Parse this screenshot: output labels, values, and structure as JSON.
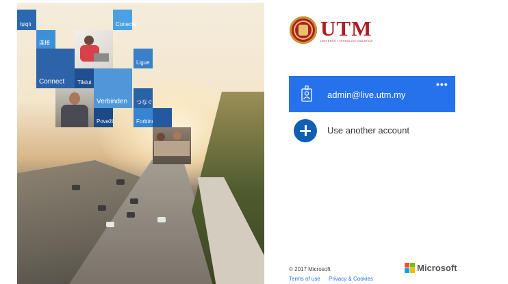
{
  "hero": {
    "tiles": [
      "Işiqlı",
      "连接",
      "Conecte",
      "Connect",
      "Ligue",
      "Verbinden",
      "つなぐ",
      "Forbind",
      "Poveži",
      "Tilslut"
    ]
  },
  "brand": {
    "name": "UTM",
    "subtitle": "UNIVERSITI TEKNOLOGI MALAYSIA",
    "color": "#b01d23"
  },
  "account": {
    "email": "admin@live.utm.my",
    "more_label": "•••",
    "icon": "badge-person-icon",
    "color": "#2672ec"
  },
  "another_account": {
    "label": "Use another account",
    "icon": "plus-circle-icon"
  },
  "footer": {
    "copyright": "© 2017 Microsoft",
    "terms": "Terms of use",
    "privacy": "Privacy & Cookies",
    "ms_label": "Microsoft",
    "ms_colors": [
      "#f25022",
      "#7fba00",
      "#00a4ef",
      "#ffb900"
    ]
  }
}
